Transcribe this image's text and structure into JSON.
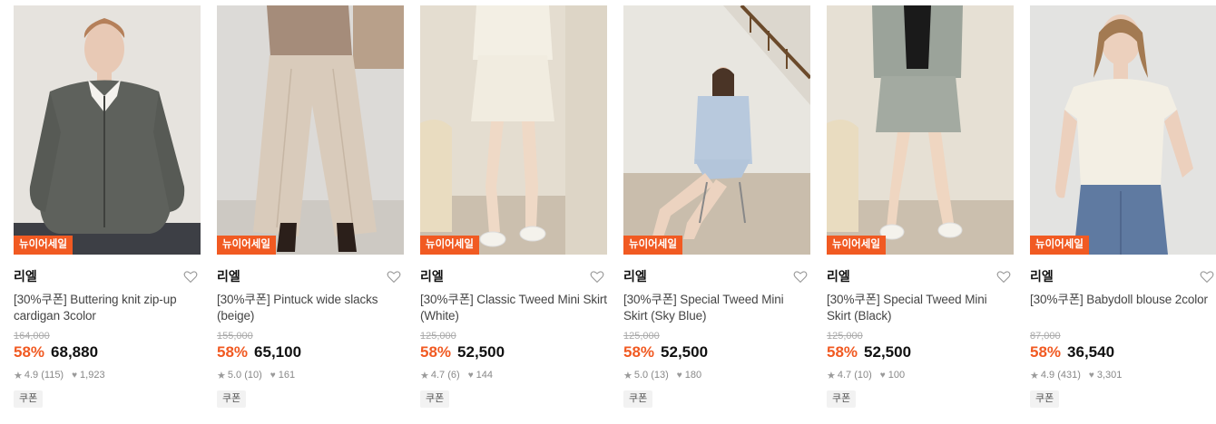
{
  "badge_label": "뉴이어세일",
  "coupon_label": "쿠폰",
  "accent_color": "#f15a22",
  "products": [
    {
      "brand": "리엘",
      "title": "[30%쿠폰] Buttering knit zip-up cardigan 3color",
      "original_price": "164,000",
      "discount": "58%",
      "price": "68,880",
      "rating": "4.9",
      "reviews": "(115)",
      "likes": "1,923",
      "image": "woman in grey knit zip-up cardigan",
      "icons": {
        "wishlist": "heart-outline-icon",
        "rating": "star-icon",
        "likes": "heart-filled-icon"
      }
    },
    {
      "brand": "리엘",
      "title": "[30%쿠폰] Pintuck wide slacks (beige)",
      "original_price": "155,000",
      "discount": "58%",
      "price": "65,100",
      "rating": "5.0",
      "reviews": "(10)",
      "likes": "161",
      "image": "beige wide slacks with brown boots",
      "icons": {
        "wishlist": "heart-outline-icon",
        "rating": "star-icon",
        "likes": "heart-filled-icon"
      }
    },
    {
      "brand": "리엘",
      "title": "[30%쿠폰] Classic Tweed Mini Skirt (White)",
      "original_price": "125,000",
      "discount": "58%",
      "price": "52,500",
      "rating": "4.7",
      "reviews": "(6)",
      "likes": "144",
      "image": "white tweed mini skirt with sneakers",
      "icons": {
        "wishlist": "heart-outline-icon",
        "rating": "star-icon",
        "likes": "heart-filled-icon"
      }
    },
    {
      "brand": "리엘",
      "title": "[30%쿠폰] Special Tweed Mini Skirt (Sky Blue)",
      "original_price": "125,000",
      "discount": "58%",
      "price": "52,500",
      "rating": "5.0",
      "reviews": "(13)",
      "likes": "180",
      "image": "woman seated in sky blue tweed set by staircase",
      "icons": {
        "wishlist": "heart-outline-icon",
        "rating": "star-icon",
        "likes": "heart-filled-icon"
      }
    },
    {
      "brand": "리엘",
      "title": "[30%쿠폰] Special Tweed Mini Skirt (Black)",
      "original_price": "125,000",
      "discount": "58%",
      "price": "52,500",
      "rating": "4.7",
      "reviews": "(10)",
      "likes": "100",
      "image": "black and white tweed jacket and mini skirt",
      "icons": {
        "wishlist": "heart-outline-icon",
        "rating": "star-icon",
        "likes": "heart-filled-icon"
      }
    },
    {
      "brand": "리엘",
      "title": "[30%쿠폰] Babydoll blouse 2color",
      "original_price": "87,000",
      "discount": "58%",
      "price": "36,540",
      "rating": "4.9",
      "reviews": "(431)",
      "likes": "3,301",
      "image": "woman in white babydoll blouse and jeans",
      "icons": {
        "wishlist": "heart-outline-icon",
        "rating": "star-icon",
        "likes": "heart-filled-icon"
      }
    }
  ]
}
